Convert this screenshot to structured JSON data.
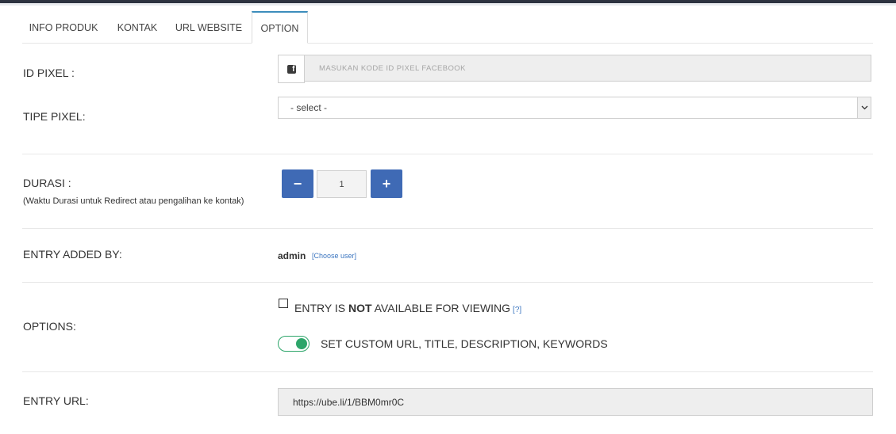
{
  "tabs": [
    {
      "label": "INFO PRODUK"
    },
    {
      "label": "KONTAK"
    },
    {
      "label": "URL WEBSITE"
    },
    {
      "label": "OPTION"
    }
  ],
  "pixel": {
    "label": "ID PIXEL :",
    "placeholder": "MASUKAN KODE ID PIXEL FACEBOOK",
    "icon": "facebook-icon"
  },
  "tipe_pixel": {
    "label": "TIPE PIXEL:",
    "selected": "- select -"
  },
  "durasi": {
    "label": "DURASI :",
    "hint": "(Waktu Durasi untuk Redirect atau pengalihan ke kontak)",
    "value": "1",
    "minus": "−",
    "plus": "+"
  },
  "entry_added_by": {
    "label": "ENTRY ADDED BY:",
    "user": "admin",
    "choose_link": "[Choose user]"
  },
  "options": {
    "label": "OPTIONS:",
    "checkbox_prefix": "ENTRY IS ",
    "checkbox_bold": "NOT",
    "checkbox_suffix": " AVAILABLE FOR VIEWING",
    "help": "[?]",
    "toggle_label": "SET CUSTOM URL, TITLE, DESCRIPTION, KEYWORDS",
    "toggle_color": "#2da56a"
  },
  "entry_url": {
    "label": "ENTRY URL:",
    "value": "https://ube.li/1/BBM0mr0C"
  },
  "colors": {
    "primary_button": "#3f6ab5",
    "active_tab_border": "#3c8dbc",
    "link": "#3c76c0"
  }
}
